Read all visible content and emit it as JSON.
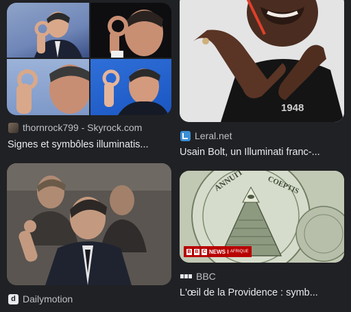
{
  "results": [
    {
      "source": "thornrock799 - Skyrock.com",
      "title": "Signes et symbôles illuminatis...",
      "favicon": "skyrock-favicon"
    },
    {
      "source": "Leral.net",
      "title": "Usain Bolt, un Illuminati franc-...",
      "favicon": "leral-favicon",
      "image_text": "1948"
    },
    {
      "source": "Dailymotion",
      "title": "",
      "favicon": "dailymotion-favicon",
      "favicon_letter": "d"
    },
    {
      "source": "BBC",
      "title": "L'œil de la Providence : symb...",
      "favicon": "bbc-favicon",
      "badge": {
        "news": "NEWS",
        "region": "AFRIQUE"
      },
      "seal_text_top": "ANNUIT",
      "seal_text_right": "COEPTIS"
    }
  ],
  "colors": {
    "background": "#202124",
    "caption_text": "#e8eaed",
    "source_text": "#bdc1c6",
    "bbc_red": "#b80000",
    "leral_blue": "#3b8fd6"
  }
}
